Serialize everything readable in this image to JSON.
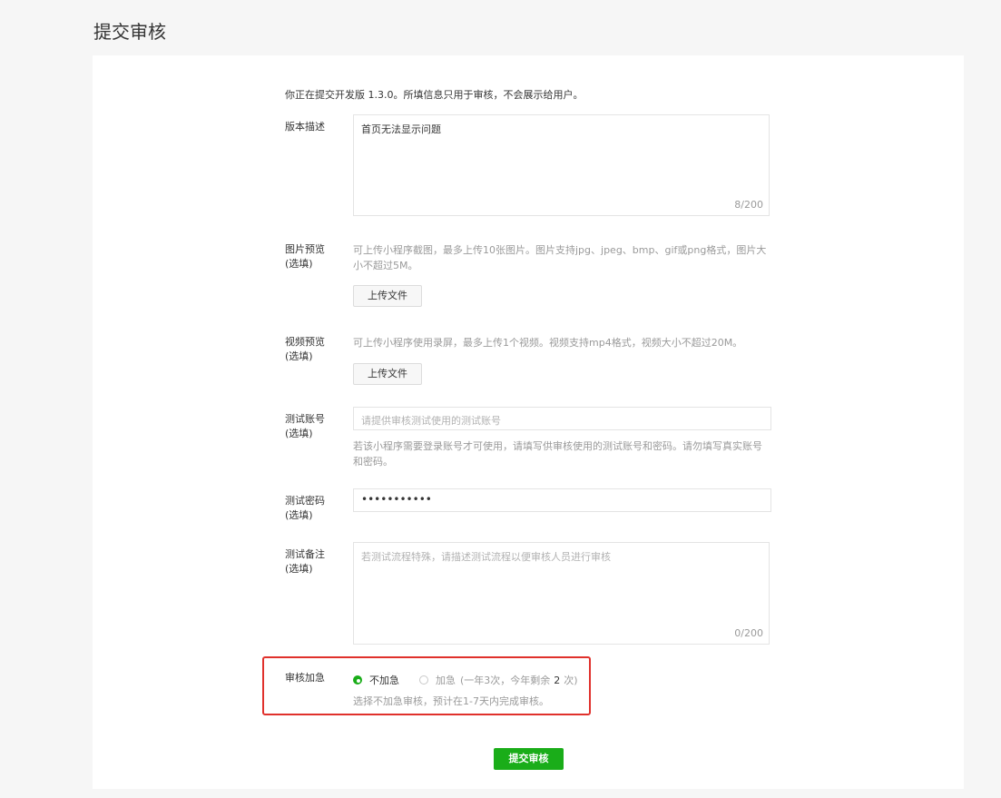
{
  "page": {
    "title": "提交审核"
  },
  "form": {
    "intro": "你正在提交开发版 1.3.0。所填信息只用于审核，不会展示给用户。",
    "version_desc": {
      "label": "版本描述",
      "value": "首页无法显示问题",
      "counter": "8/200"
    },
    "image_preview": {
      "label": "图片预览",
      "optional": "(选填)",
      "hint": "可上传小程序截图，最多上传10张图片。图片支持jpg、jpeg、bmp、gif或png格式，图片大小不超过5M。",
      "upload_label": "上传文件"
    },
    "video_preview": {
      "label": "视频预览",
      "optional": "(选填)",
      "hint": "可上传小程序使用录屏，最多上传1个视频。视频支持mp4格式，视频大小不超过20M。",
      "upload_label": "上传文件"
    },
    "test_account": {
      "label": "测试账号",
      "optional": "(选填)",
      "placeholder": "请提供审核测试使用的测试账号",
      "hint": "若该小程序需要登录账号才可使用，请填写供审核使用的测试账号和密码。请勿填写真实账号和密码。"
    },
    "test_password": {
      "label": "测试密码",
      "optional": "(选填)",
      "value": "•••••••••••"
    },
    "test_notes": {
      "label": "测试备注",
      "optional": "(选填)",
      "placeholder": "若测试流程特殊，请描述测试流程以便审核人员进行审核",
      "counter": "0/200"
    },
    "urgent": {
      "label": "审核加急",
      "option_no": "不加急",
      "option_yes": "加急",
      "quota_prefix": "(一年3次，今年剩余",
      "quota_count": "2",
      "quota_suffix": "次)",
      "selected": "不加急",
      "hint": "选择不加急审核，预计在1-7天内完成审核。"
    },
    "submit_label": "提交审核"
  },
  "colors": {
    "accent": "#1aad19",
    "highlight_frame": "#e0312c"
  }
}
